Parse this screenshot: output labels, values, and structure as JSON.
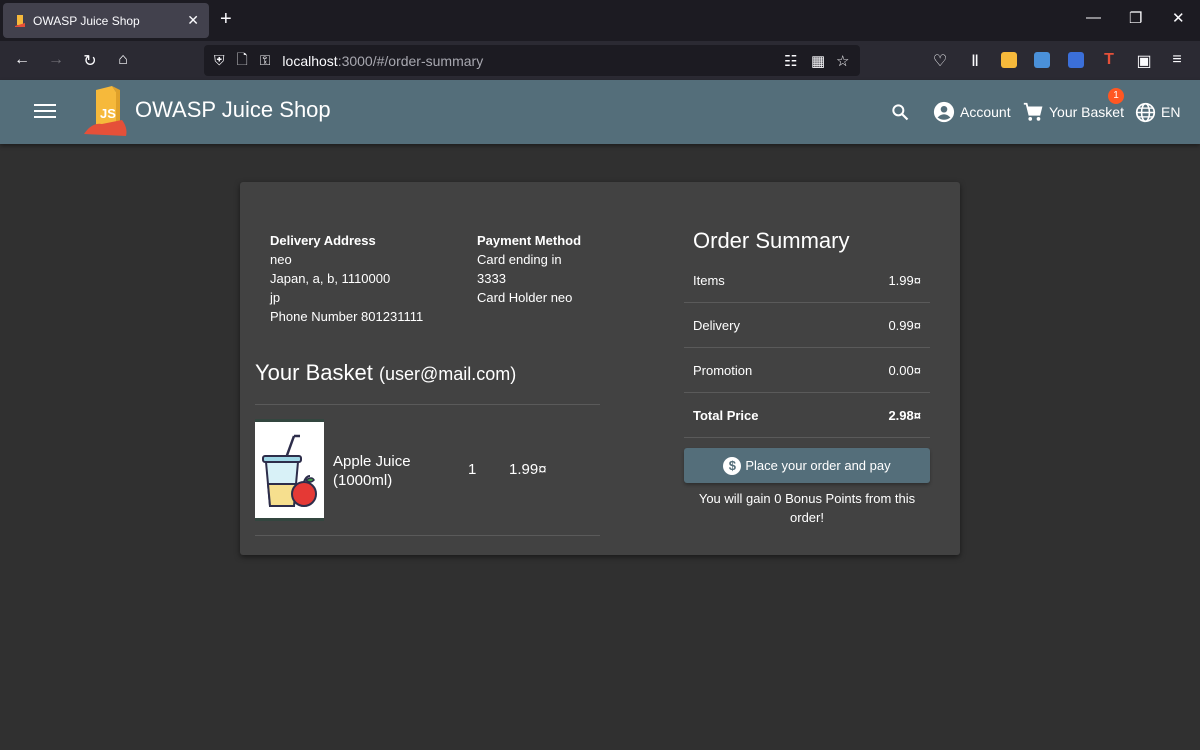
{
  "browser": {
    "tab_title": "OWASP Juice Shop",
    "tab_close": "✕",
    "new_tab": "+",
    "url_host": "localhost",
    "url_rest": ":3000/#/order-summary"
  },
  "header": {
    "title": "OWASP Juice Shop",
    "account_label": "Account",
    "basket_label": "Your Basket",
    "basket_count": "1",
    "language_label": "EN"
  },
  "delivery": {
    "heading": "Delivery Address",
    "name": "neo",
    "address": "Japan, a, b, 1110000",
    "country": "jp",
    "phone": "Phone Number 801231111"
  },
  "payment": {
    "heading": "Payment Method",
    "card_line1": "Card ending in",
    "card_line2": "3333",
    "holder": "Card Holder neo"
  },
  "basket": {
    "title": "Your Basket",
    "email": "(user@mail.com)",
    "items": [
      {
        "name": "Apple Juice (1000ml)",
        "quantity": "1",
        "price": "1.99¤"
      }
    ]
  },
  "summary": {
    "title": "Order Summary",
    "rows": [
      {
        "label": "Items",
        "value": "1.99¤"
      },
      {
        "label": "Delivery",
        "value": "0.99¤"
      },
      {
        "label": "Promotion",
        "value": "0.00¤"
      },
      {
        "label": "Total Price",
        "value": "2.98¤"
      }
    ],
    "place_order_label": "Place your order and pay",
    "bonus_text": "You will gain 0 Bonus Points from this order!"
  },
  "colors": {
    "toolbar": "#546e7a",
    "card": "#424242",
    "background": "#303030",
    "badge": "#ff5722"
  }
}
